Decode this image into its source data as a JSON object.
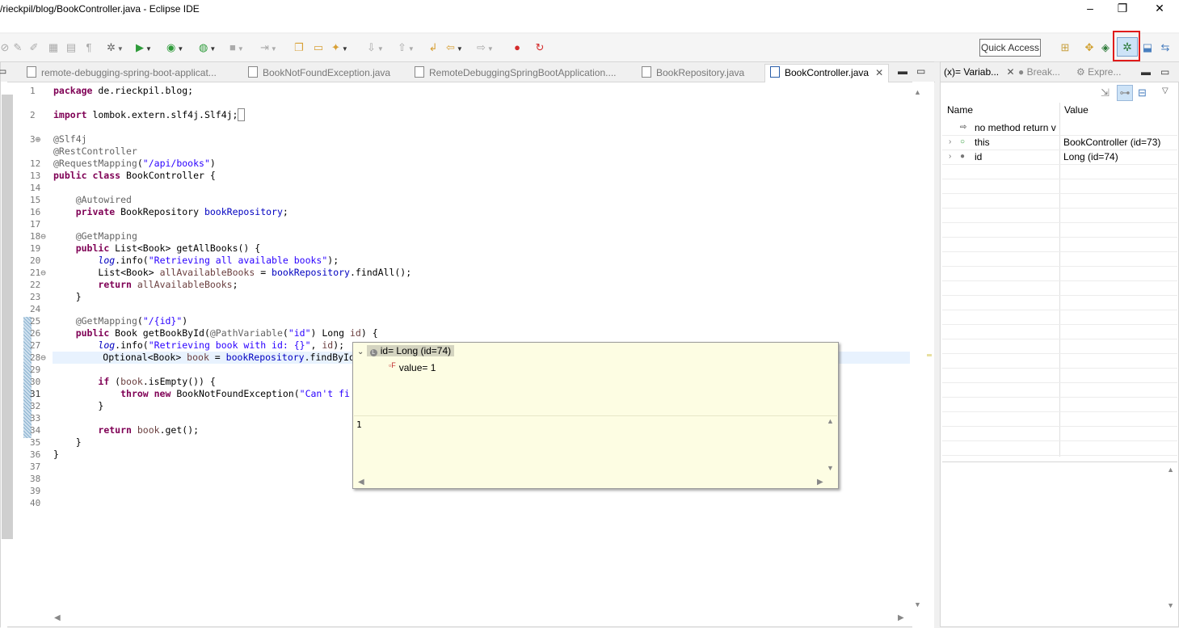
{
  "window": {
    "title": "/rieckpil/blog/BookController.java - Eclipse IDE",
    "minimize": "–",
    "maximize": "❐",
    "close": "✕"
  },
  "toolbar": {
    "quick_access": "Quick Access"
  },
  "editor": {
    "tabs": [
      {
        "label": "remote-debugging-spring-boot-applicat..."
      },
      {
        "label": "BookNotFoundException.java"
      },
      {
        "label": "RemoteDebuggingSpringBootApplication...."
      },
      {
        "label": "BookRepository.java"
      },
      {
        "label": "BookController.java",
        "active": true
      }
    ],
    "line_numbers": [
      "1",
      "2",
      "3⊕",
      "12",
      "13",
      "14",
      "15",
      "16",
      "17",
      "18⊖",
      "19",
      "20",
      "21⊖",
      "22",
      "23",
      "24",
      "25",
      "26",
      "27",
      "28⊖",
      "29",
      "30",
      "31",
      "32",
      "33",
      "34",
      "35",
      "36",
      "37",
      "38",
      "39",
      "40"
    ],
    "current_line": "31"
  },
  "hover": {
    "header_name": "id= Long  (id=74)",
    "child": "value= 1",
    "detail_value": "1"
  },
  "variables": {
    "tabs": [
      {
        "label": "(x)= Variab...",
        "active": true
      },
      {
        "label": "Break..."
      },
      {
        "label": "Expre..."
      }
    ],
    "col_name": "Name",
    "col_value": "Value",
    "rows": [
      {
        "name": "no method return v",
        "value": "",
        "icon": "return-icon"
      },
      {
        "name": "this",
        "value": "BookController  (id=73)",
        "icon": "field-icon"
      },
      {
        "name": "id",
        "value": "Long  (id=74)",
        "icon": "local-icon"
      }
    ]
  },
  "colors": {
    "keyword": "#7f0055",
    "string": "#2a00ff",
    "field": "#0000c0",
    "annotation": "#646464",
    "current_line": "#e8f2fe",
    "hover_bg": "#fdfde3",
    "highlight_box": "#e01b1b"
  }
}
